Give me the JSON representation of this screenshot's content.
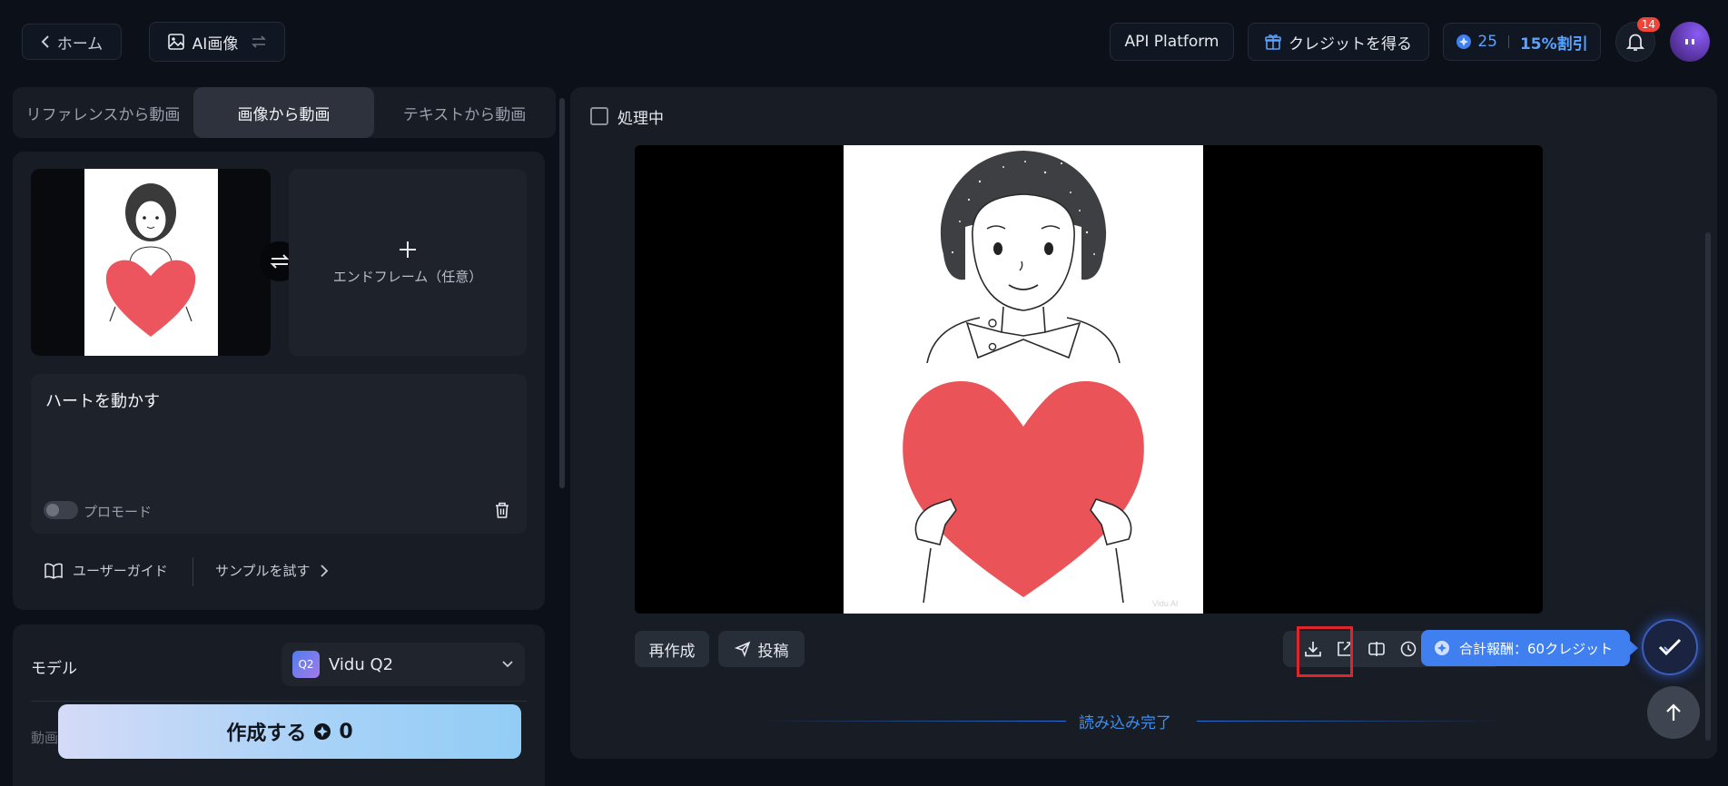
{
  "header": {
    "home_label": "ホーム",
    "ai_image_label": "AI画像",
    "api_label": "API Platform",
    "credit_label": "クレジットを得る",
    "balance_value": "25",
    "discount_label": "15%割引",
    "notification_count": "14",
    "accent_color": "#3f7ff0"
  },
  "left": {
    "tabs": [
      {
        "label": "リファレンスから動画"
      },
      {
        "label": "画像から動画"
      },
      {
        "label": "テキストから動画"
      }
    ],
    "end_frame_label": "エンドフレーム（任意）",
    "prompt_text": "ハートを動かす",
    "pro_mode_label": "プロモード",
    "user_guide_label": "ユーザーガイド",
    "try_sample_label": "サンプルを試す",
    "model_label": "モデル",
    "model_value": "Vidu Q2",
    "model_badge": "Q2",
    "model_sub_label": "動画",
    "create_label": "作成する",
    "create_cost": "0"
  },
  "right": {
    "processing_label": "処理中",
    "regen_label": "再作成",
    "post_label": "投稿",
    "reward_label": "合計報酬：60クレジット",
    "load_complete_label": "読み込み完了",
    "watermark": "Vidu AI"
  }
}
